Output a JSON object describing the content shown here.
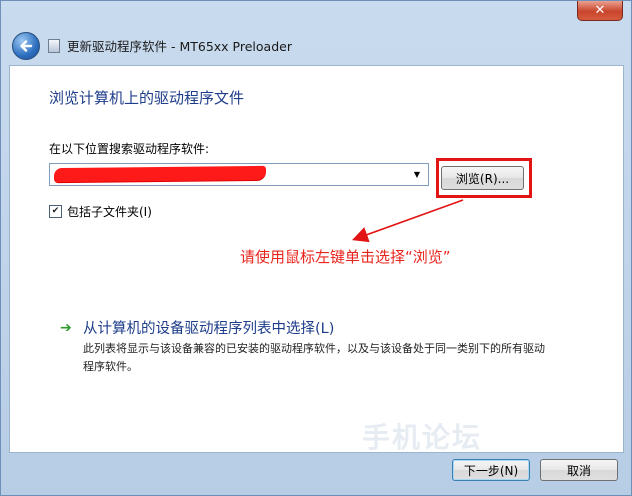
{
  "window": {
    "title": "更新驱动程序软件 - MT65xx Preloader",
    "close_glyph": "✕",
    "back_icon": "back-arrow-icon"
  },
  "page": {
    "heading": "浏览计算机上的驱动程序文件",
    "search_label": "在以下位置搜索驱动程序软件:",
    "path_value_redacted": true,
    "browse_label": "浏览(R)...",
    "include_subfolders_label": "包括子文件夹(I)",
    "include_subfolders_checked": true
  },
  "annotation": {
    "text": "请使用鼠标左键单击选择“浏览”",
    "color": "#e8251d"
  },
  "option": {
    "title": "从计算机的设备驱动程序列表中选择(L)",
    "description": "此列表将显示与该设备兼容的已安装的驱动程序软件，以及与该设备处于同一类别下的所有驱动程序软件。"
  },
  "watermark": {
    "text": "手机论坛"
  },
  "footer": {
    "next_label": "下一步(N)",
    "cancel_label": "取消"
  },
  "colors": {
    "heading": "#1e3d8a",
    "highlight": "#e21414",
    "option_arrow": "#2e9b2e"
  }
}
